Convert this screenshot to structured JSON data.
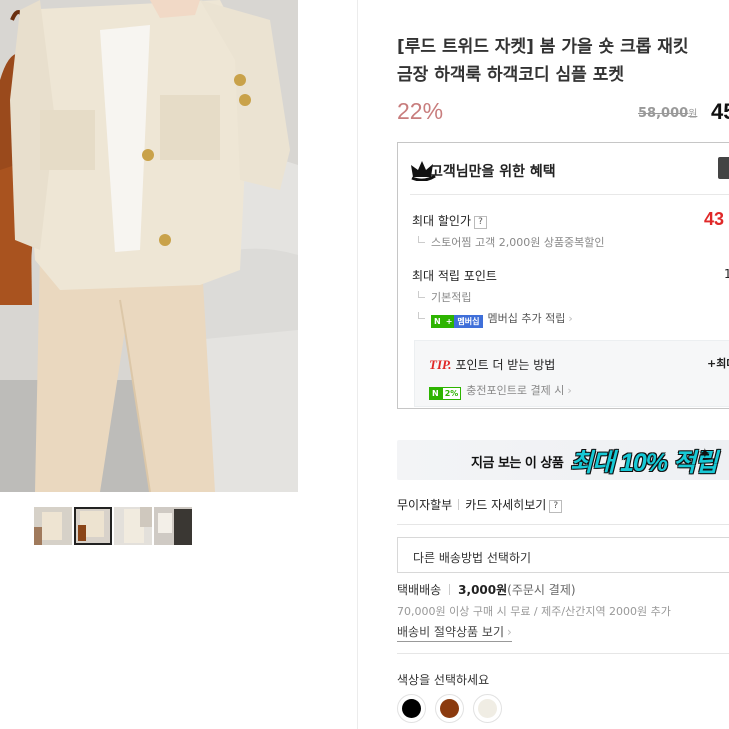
{
  "product": {
    "title_line1": "[루드 트위드 자켓] 봄 가을 숏 크롭 재킷",
    "title_line2": "금장 하객룩 하객코디 심플 포켓",
    "discount": "22%",
    "original_price": "58,000",
    "original_price_unit": "원",
    "sale_price": "45"
  },
  "gallery": {
    "main_image": "tweed-jacket-photo",
    "thumbnails": [
      {
        "name": "thumb-1",
        "selected": false
      },
      {
        "name": "thumb-2",
        "selected": true
      },
      {
        "name": "thumb-3",
        "selected": false
      },
      {
        "name": "thumb-4",
        "selected": false
      }
    ]
  },
  "benefit": {
    "title": "고객님만을 위한 혜택",
    "max_discount_label": "최대 할인가",
    "max_discount_value": "43",
    "store_coupon": "스토어찜 고객 2,000원 상품중복할인",
    "max_points_label": "최대 적립 포인트",
    "max_points_value": "1",
    "basic_points": "기본적립",
    "membership_badge_n": "N",
    "membership_badge_plus": "+",
    "membership_badge_text": "멤버십",
    "membership_points": "멤버십 추가 적립",
    "tip_label": "TIP.",
    "tip_title": "포인트 더 받는 방법",
    "tip_more": "+최대",
    "charge_badge_n": "N",
    "charge_badge_pct": "2%",
    "charge_points": "충전포인트로 결제 시"
  },
  "promo": {
    "text_a": "지금 보는 이 상품",
    "text_b": "최대 10% 적립",
    "sparkle": "✦"
  },
  "payment": {
    "installment": "무이자할부",
    "card_detail": "카드 자세히보기",
    "qmark": "?"
  },
  "shipping": {
    "select_placeholder": "다른 배송방법 선택하기",
    "method": "택배배송",
    "fee": "3,000원",
    "fee_note": "(주문시 결제)",
    "free_note": "70,000원 이상 구매 시 무료 / 제주/산간지역 2000원 추가",
    "saver_link": "배송비 절약상품 보기"
  },
  "options": {
    "color_label": "색상을 선택하세요",
    "colors": [
      "#000000",
      "#8b3a0e",
      "#f0ede4"
    ]
  },
  "icons": {
    "crown": "crown-icon",
    "chevron": "›"
  }
}
